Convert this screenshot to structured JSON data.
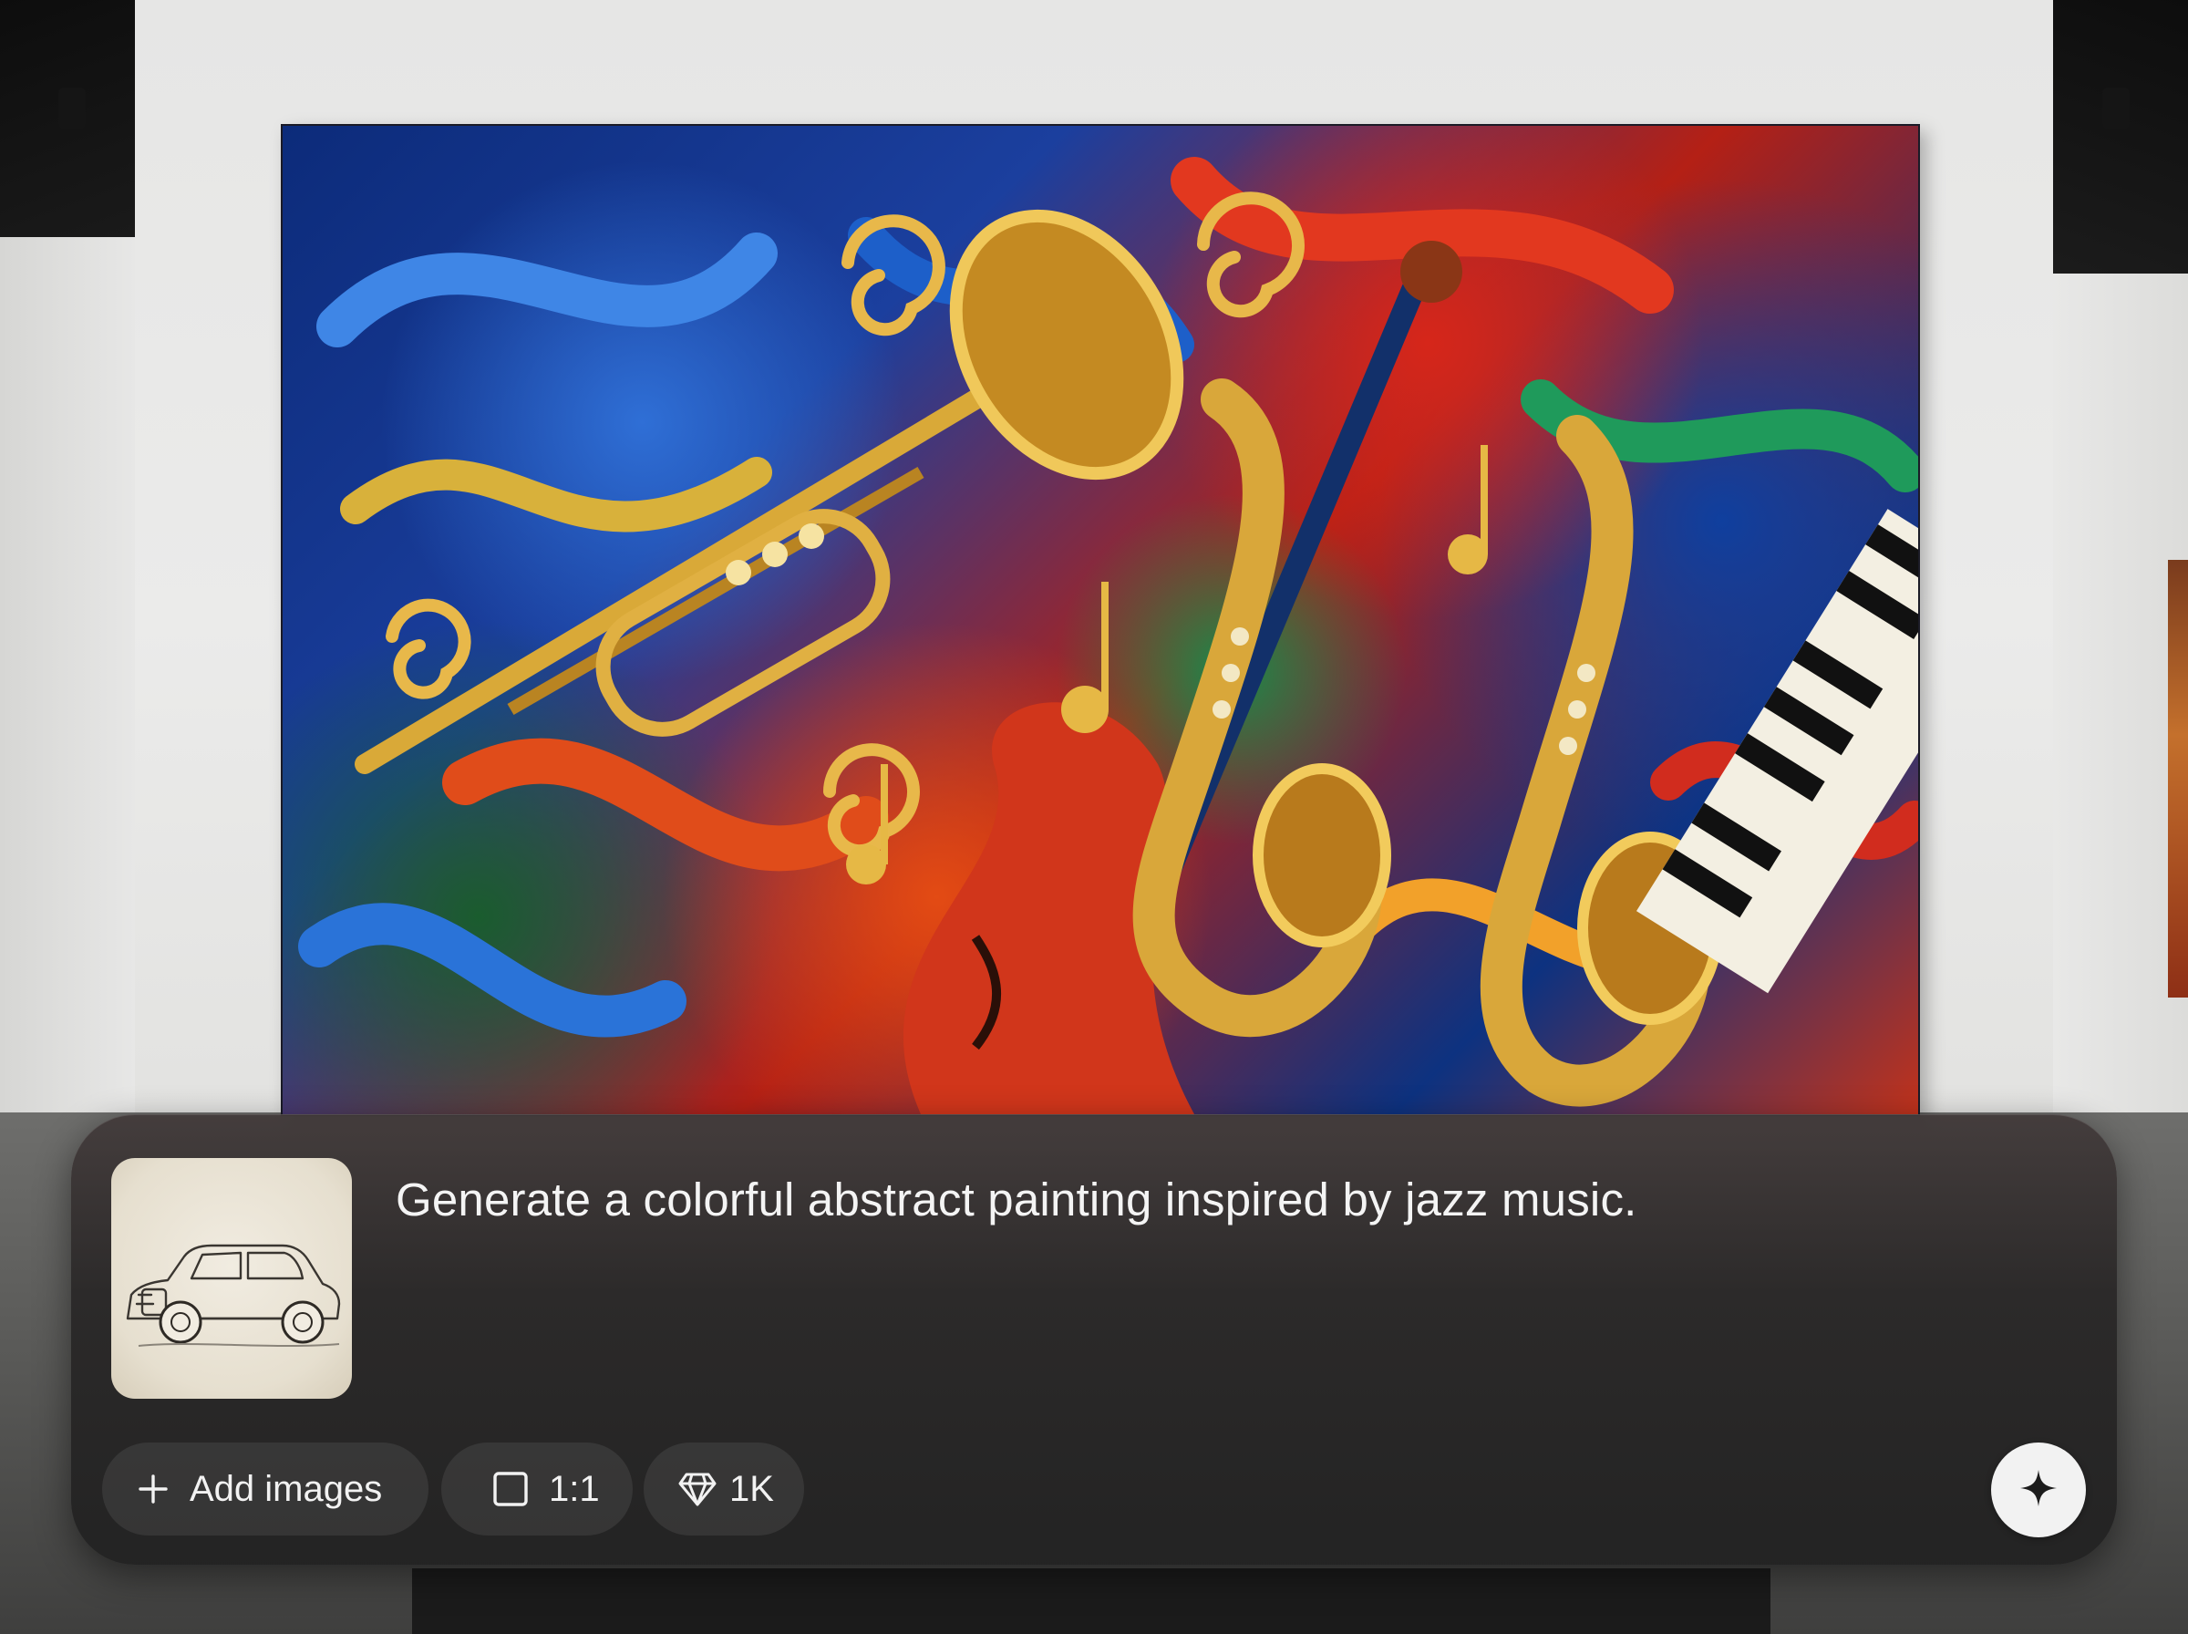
{
  "prompt": {
    "text": "Generate a colorful abstract painting inspired by jazz music."
  },
  "reference_image": {
    "icon": "car-sketch-thumbnail"
  },
  "toolbar": {
    "add_images_label": "Add images",
    "add_images_icon": "plus-icon",
    "aspect_ratio_label": "1:1",
    "aspect_ratio_icon": "square-icon",
    "quality_label": "1K",
    "quality_icon": "diamond-icon",
    "generate_icon": "sparkle-icon"
  },
  "colors": {
    "panel_background": "#2c2a2a",
    "text": "#f4f4f4",
    "send_button": "#f2f2f2"
  }
}
